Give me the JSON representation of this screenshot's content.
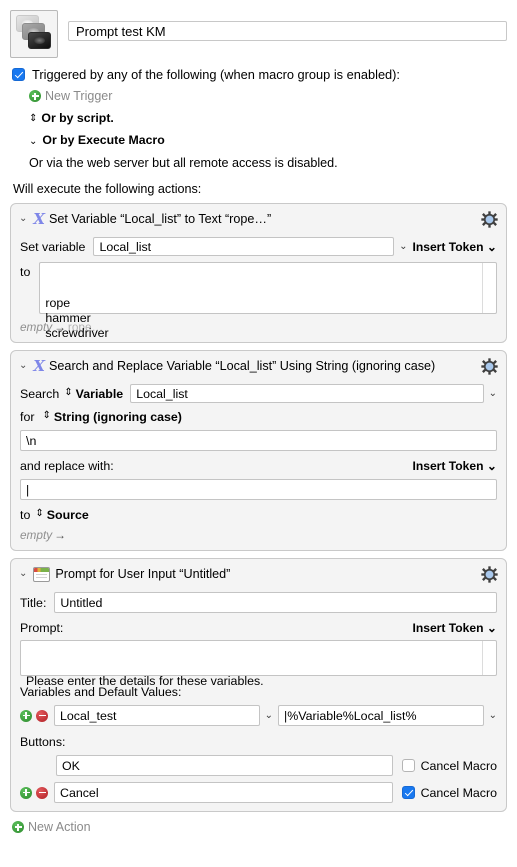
{
  "header": {
    "macro_icon": "macro-stack-icon",
    "title_value": "Prompt test KM"
  },
  "triggers": {
    "enabled_checkbox_label": "Triggered by any of the following (when macro group is enabled):",
    "enabled": true,
    "new_trigger_label": "New Trigger",
    "new_trigger_icon": "plus-circle-icon",
    "or_by_script": "Or by script.",
    "or_by_execute_macro": "Or by Execute Macro",
    "web_server_note": "Or via the web server but all remote access is disabled.",
    "will_execute_label": "Will execute the following actions:"
  },
  "actions": [
    {
      "icon": "variable-x-icon",
      "disclosure": "⌄",
      "title": "Set Variable “Local_list” to Text “rope…”",
      "gear": "gear-icon",
      "set_variable_label": "Set variable",
      "variable_name": "Local_list",
      "insert_token_label": "Insert Token",
      "to_label": "to",
      "text_value": "rope\nhammer\nscrewdriver",
      "footer_from": "empty",
      "footer_arrow": "→",
      "footer_to": "rope…"
    },
    {
      "icon": "variable-x-icon",
      "disclosure": "⌄",
      "title": "Search and Replace Variable “Local_list” Using String (ignoring case)",
      "gear": "gear-icon",
      "search_label": "Search",
      "search_target_label": "Variable",
      "search_variable_value": "Local_list",
      "for_label": "for",
      "for_mode_label": "String (ignoring case)",
      "search_pattern": "\\n",
      "replace_label": "and replace with:",
      "insert_token_label": "Insert Token",
      "replace_value": "|",
      "to_label": "to",
      "to_target_label": "Source",
      "footer_from": "empty",
      "footer_arrow": "→",
      "footer_to": ""
    },
    {
      "icon": "prompt-window-icon",
      "disclosure": "⌄",
      "title": "Prompt for User Input “Untitled”",
      "gear": "gear-icon",
      "title_label": "Title:",
      "title_value": "Untitled",
      "prompt_label": "Prompt:",
      "insert_token_label": "Insert Token",
      "prompt_value": "Please enter the details for these variables.",
      "variables_label": "Variables and Default Values:",
      "variable_rows": [
        {
          "add_icon": "plus-circle-icon",
          "remove_icon": "minus-circle-icon",
          "name": "Local_test",
          "default_value": "|%Variable%Local_list%"
        }
      ],
      "buttons_label": "Buttons:",
      "button_rows": [
        {
          "label": "OK",
          "cancel_macro_label": "Cancel Macro",
          "cancel_macro_checked": false,
          "has_pm": false
        },
        {
          "label": "Cancel",
          "cancel_macro_label": "Cancel Macro",
          "cancel_macro_checked": true,
          "has_pm": true,
          "add_icon": "plus-circle-icon",
          "remove_icon": "minus-circle-icon"
        }
      ]
    }
  ],
  "footer": {
    "new_action_label": "New Action",
    "new_action_icon": "plus-circle-icon"
  },
  "colors": {
    "accent_blue": "#1878f0",
    "green": "#2c8a2c",
    "red": "#b01f24",
    "variable_purple": "#7e86e8",
    "card_bg": "#f4f4f4",
    "card_border": "#c9c9c9"
  }
}
